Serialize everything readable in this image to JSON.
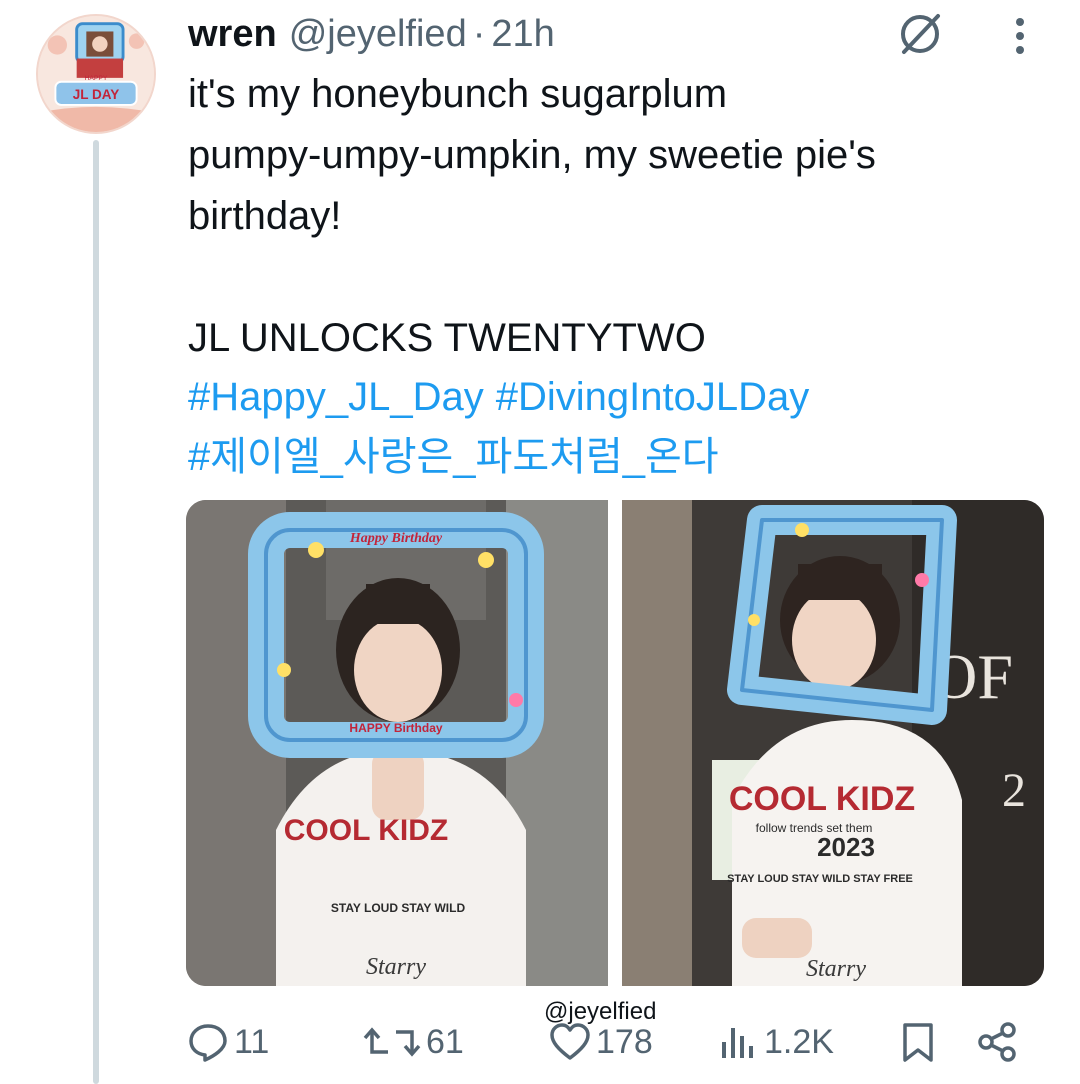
{
  "tweet": {
    "author_name": "wren",
    "handle": "@jeyelfied",
    "separator": "·",
    "time": "21h",
    "text_lines": [
      "it's my honeybunch sugarplum",
      "pumpy-umpy-umpkin, my sweetie pie's",
      "birthday!",
      "",
      "JL UNLOCKS TWENTYTWO"
    ],
    "hashtags": [
      "#Happy_JL_Day",
      "#DivingIntoJLDay",
      "#제이엘_사랑은_파도처럼_온다"
    ]
  },
  "avatar": {
    "banner": "JL DAY",
    "small_text": "HAPPY"
  },
  "media": {
    "photo_left": {
      "balloon_top": "Happy Birthday",
      "balloon_bottom": "HAPPY Birthday",
      "shirt_text": "COOL KIDZ",
      "shirt_bottom": "STAY LOUD STAY WILD",
      "signature": "Starry"
    },
    "photo_right": {
      "shirt_text": "COOL KIDZ",
      "shirt_small": "follow trends set them",
      "shirt_year": "2023",
      "shirt_bottom": "STAY LOUD STAY WILD STAY FREE",
      "signature": "Starry",
      "backdrop_text": "OF",
      "backdrop_number": "2"
    },
    "watermark": "@jeyelfied"
  },
  "actions": {
    "reply_count": "11",
    "retweet_count": "61",
    "like_count": "178",
    "views_count": "1.2K"
  },
  "colors": {
    "text": "#0f1419",
    "secondary": "#536471",
    "link": "#1d9bf0",
    "thread_line": "#cfd9de"
  },
  "icons": [
    "grok-icon",
    "more-icon",
    "reply-icon",
    "retweet-icon",
    "like-icon",
    "views-icon",
    "bookmark-icon",
    "share-icon"
  ]
}
